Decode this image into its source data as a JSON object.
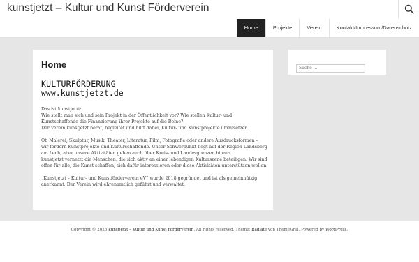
{
  "header": {
    "site_title": "kunstjetzt – Kultur und Kunst Förderverein",
    "nav": [
      {
        "label": "Home"
      },
      {
        "label": "Projekte"
      },
      {
        "label": "Verein"
      },
      {
        "label": "Kontakt/Impressum/Datenschutz"
      }
    ],
    "search_icon": "search-icon"
  },
  "content": {
    "page_title": "Home",
    "logo_line1": "KULTURFÖRDERUNG",
    "logo_line2": "www.kunstjetzt.de",
    "p1": [
      "Das ist kunstjetzt:",
      "Wie stellt man sich und sein Projekt in der Öffentlichkeit vor? Wie stellen Kultur- und",
      "Kunstschaffende die Finanzierung ihrer Projekte auf die Beine?",
      "Der Verein kunstjetzt berät, begleitet und hilft dabei, Kultur- und Kunstprojekte umzusetzen."
    ],
    "p2": [
      "Ob Malerei, Skulptur, Musik, Theater, Literatur, Film, Fotografie oder andere Ausdrucksformen –",
      "wir fördern Kunstprojekte und Kulturschaffende. Unser Schwerpunkt liegt auf der Region Landsberg",
      "am Lech, aber unsere Aktivitäten gehen auch über Kreis- und Landesgrenzen hinaus.",
      "kunstjetzt vernetzt die Menschen, die sich aktiv an einer lebendigen Kulturszene beteiligen. Wir sind",
      "offen für alle, die Kunst schaffen, sich dafür interessieren oder diese Aktivitäten unterstützen wollen."
    ],
    "p3": [
      "„Kunstjetzt – Kultur- und Kunstförderverein eV“ wurde 2018 gegründet und ist als gemeinnützig",
      "anerkannt. Der Verein wird ehrenamtlich geführt und verwaltet."
    ]
  },
  "sidebar": {
    "search_placeholder": "Suche …"
  },
  "footer": {
    "copyright_prefix": "Copyright © 2025 ",
    "site_name": "kunstjetzt – Kultur und Kunst Förderverein",
    "rights_theme": ". All rights reserved. Theme: ",
    "theme_name": "Radiate",
    "by": " von ThemeGrill. Powered by ",
    "powered": "WordPress",
    "end": "."
  },
  "colors": {
    "nav_active_bg": "#222222",
    "page_bg": "#e6e6e6"
  }
}
